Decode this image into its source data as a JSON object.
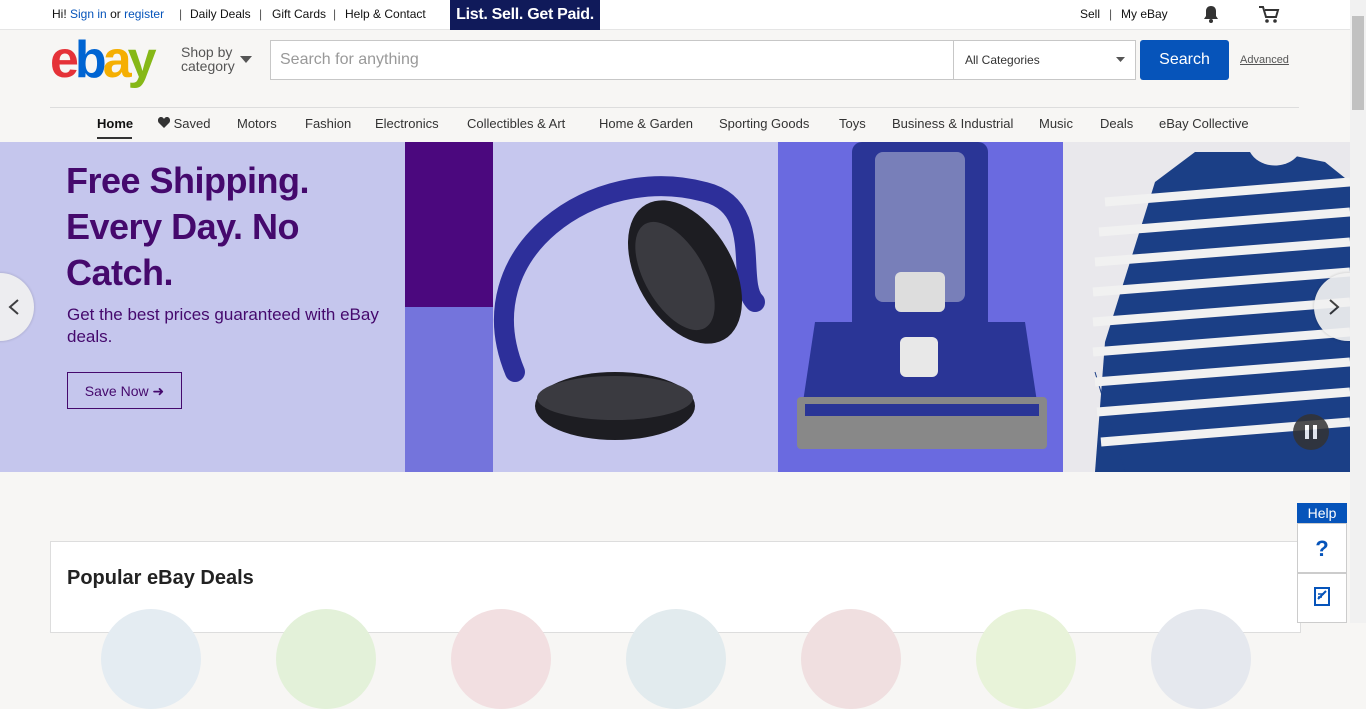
{
  "topbar": {
    "greeting_prefix": "Hi!",
    "sign_in": "Sign in",
    "or": "or",
    "register": "register",
    "daily_deals": "Daily Deals",
    "gift_cards": "Gift Cards",
    "help_contact": "Help & Contact",
    "promo": "List. Sell. Get Paid.",
    "sell": "Sell",
    "my_ebay": "My eBay",
    "bell_icon": "bell-icon",
    "cart_icon": "cart-icon"
  },
  "header": {
    "logo_letters": [
      "e",
      "b",
      "a",
      "y"
    ],
    "logo_colors": [
      "#e53238",
      "#0064d2",
      "#f5af02",
      "#86b817"
    ],
    "shop_by": "Shop by",
    "category": "category",
    "search_placeholder": "Search for anything",
    "search_value": "",
    "category_selected": "All Categories",
    "search_button": "Search",
    "advanced": "Advanced"
  },
  "nav": {
    "items": [
      "Home",
      "Saved",
      "Motors",
      "Fashion",
      "Electronics",
      "Collectibles & Art",
      "Home & Garden",
      "Sporting Goods",
      "Toys",
      "Business & Industrial",
      "Music",
      "Deals",
      "eBay Collective"
    ]
  },
  "hero": {
    "title": "Free Shipping. Every Day. No Catch.",
    "subtitle": "Get the best prices guaranteed with eBay deals.",
    "cta": "Save Now",
    "background": "#c5c6ed",
    "accent": "#45096d"
  },
  "deals": {
    "title": "Popular eBay Deals"
  },
  "help": {
    "tab": "Help",
    "question": "?",
    "feedback_icon": "feedback-icon"
  }
}
